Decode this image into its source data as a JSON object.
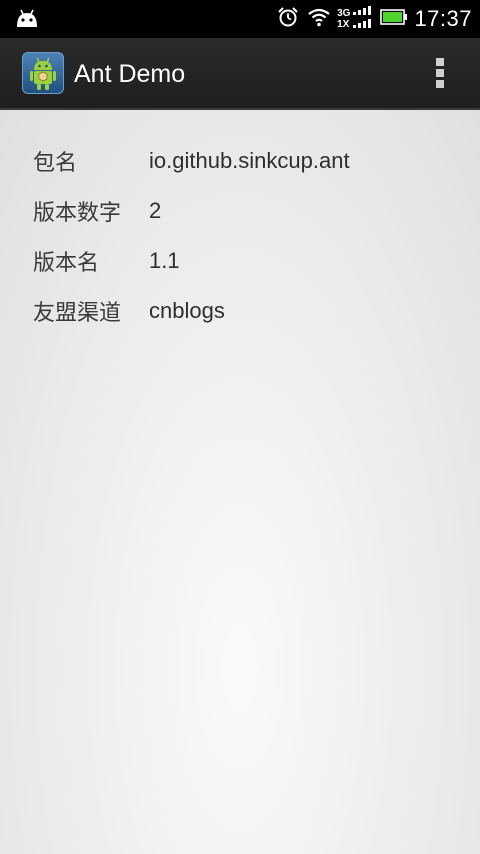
{
  "status_bar": {
    "time": "17:37",
    "network_top": "3G",
    "network_bottom": "1X",
    "icons": [
      "android-notification-icon",
      "alarm-icon",
      "wifi-icon",
      "signal-icon",
      "battery-icon"
    ],
    "battery_level": 1.0,
    "battery_color": "#4cd32c"
  },
  "action_bar": {
    "title": "Ant Demo",
    "icon": "android-app-icon",
    "overflow": "overflow-menu-icon"
  },
  "info": {
    "rows": [
      {
        "label": "包名",
        "value": "io.github.sinkcup.ant"
      },
      {
        "label": "版本数字",
        "value": "2"
      },
      {
        "label": "版本名",
        "value": "1.1"
      },
      {
        "label": "友盟渠道",
        "value": "cnblogs"
      }
    ]
  }
}
